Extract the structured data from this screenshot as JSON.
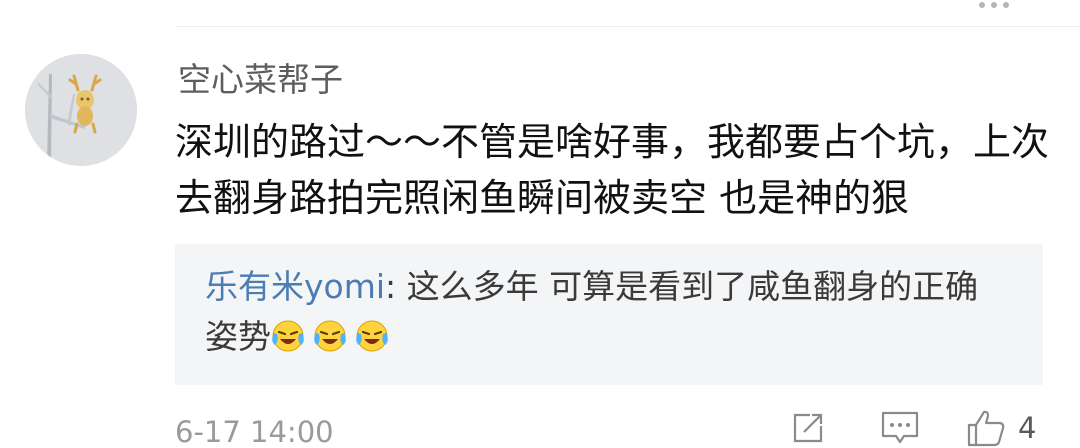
{
  "comment": {
    "username": "空心菜帮子",
    "text": "深圳的路过～～不管是啥好事，我都要占个坑，上次去翻身路拍完照闲鱼瞬间被卖空 也是神的狠",
    "reply": {
      "author": "乐有米yomi",
      "separator": ": ",
      "text": "这么多年 可算是看到了咸鱼翻身的正确姿势",
      "emojis": [
        "laugh-cry-emoji",
        "laugh-cry-emoji",
        "laugh-cry-emoji"
      ]
    },
    "timestamp": "6-17 14:00",
    "actions": {
      "share_icon": "share-icon",
      "reply_icon": "comment-icon",
      "like_icon": "thumbs-up-icon",
      "like_count": "4"
    }
  },
  "colors": {
    "author_link": "#4b7cb4",
    "reply_background": "#f4f5f7",
    "meta_gray": "#9a9a9a"
  }
}
